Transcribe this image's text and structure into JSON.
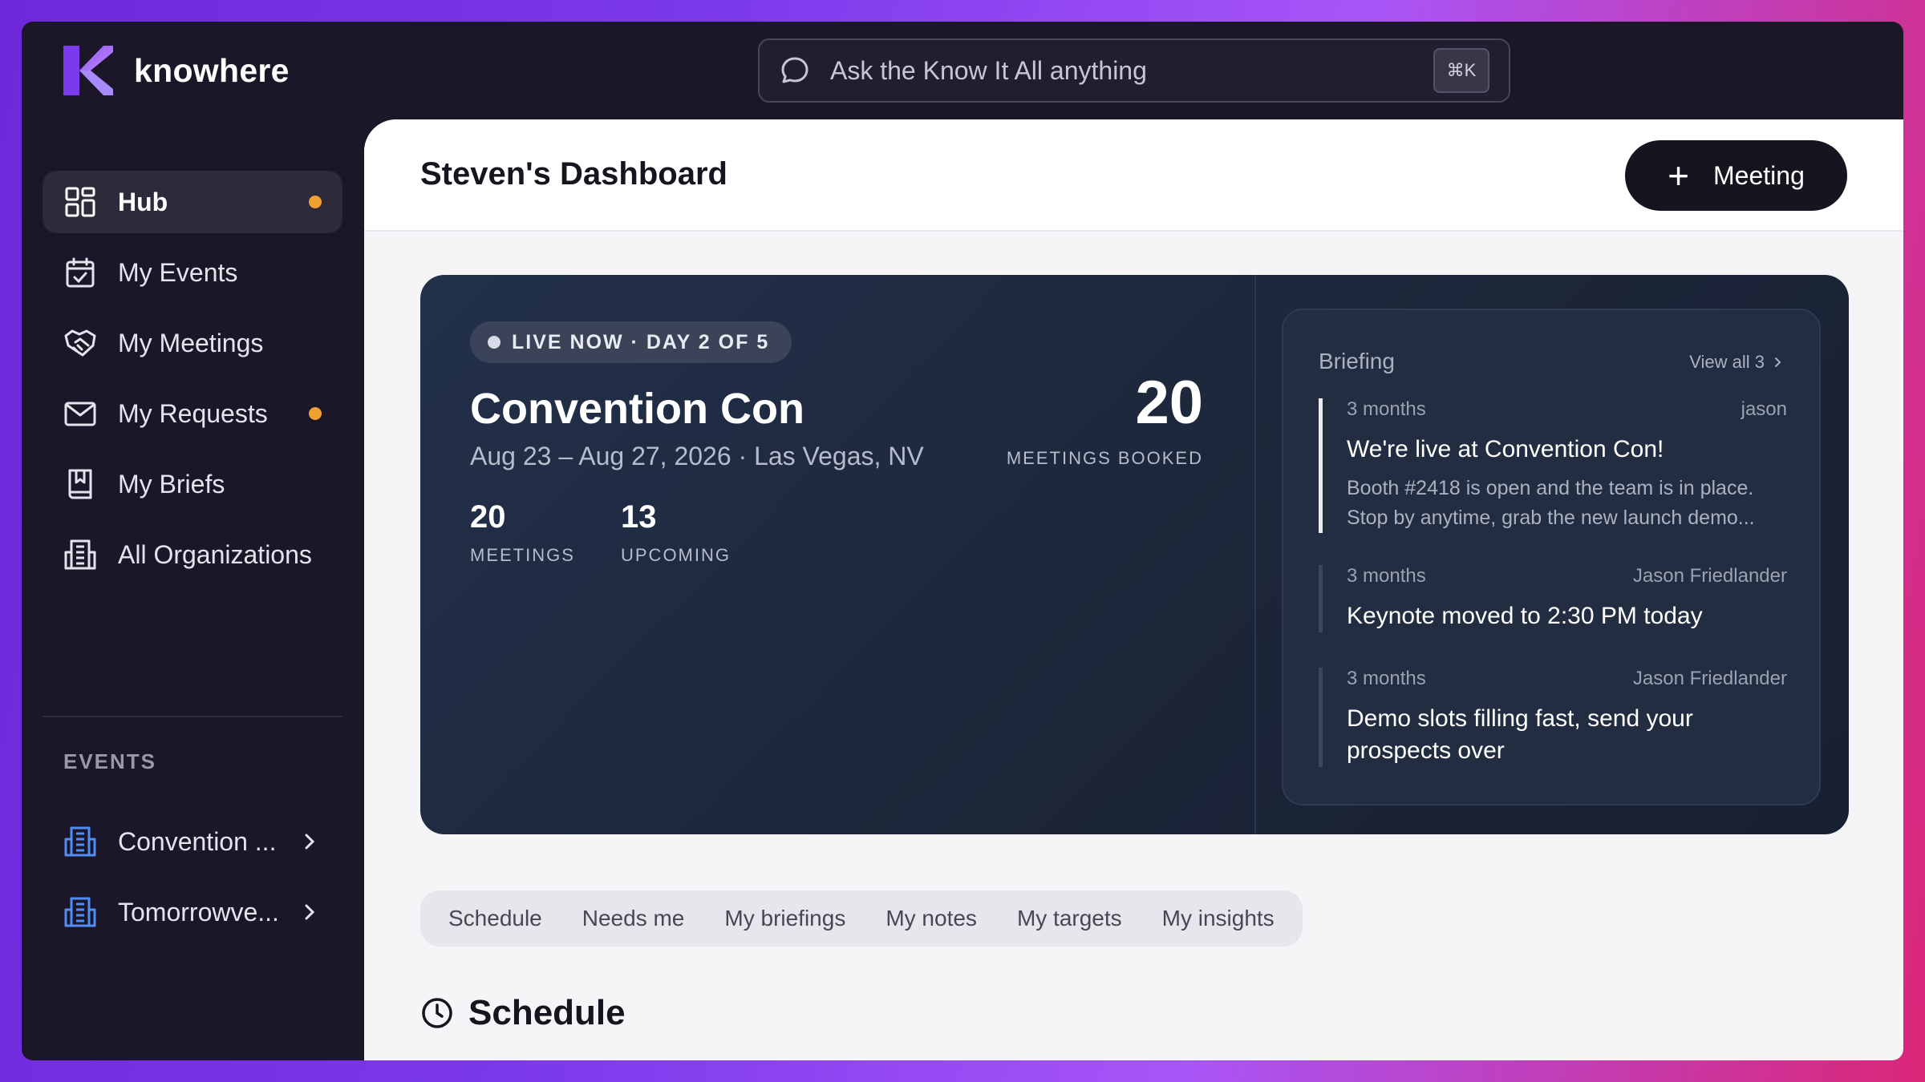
{
  "app": {
    "name": "knowhere"
  },
  "search": {
    "placeholder": "Ask the Know It All anything",
    "shortcut": "⌘K"
  },
  "sidebar": {
    "items": [
      {
        "label": "Hub",
        "icon": "grid-icon",
        "active": true,
        "badge": true
      },
      {
        "label": "My Events",
        "icon": "calendar-check-icon"
      },
      {
        "label": "My Meetings",
        "icon": "handshake-icon"
      },
      {
        "label": "My Requests",
        "icon": "mail-icon",
        "badge": true
      },
      {
        "label": "My Briefs",
        "icon": "book-icon"
      },
      {
        "label": "All Organizations",
        "icon": "building-icon"
      }
    ],
    "events_label": "EVENTS",
    "events": [
      {
        "label": "Convention ...",
        "icon": "building-icon"
      },
      {
        "label": "Tomorrowve...",
        "icon": "building-icon"
      }
    ],
    "badge_color": "#f0a030"
  },
  "header": {
    "title": "Steven's Dashboard",
    "meeting_button": "Meeting"
  },
  "hero": {
    "live_label": "LIVE NOW · DAY 2 OF 5",
    "event_name": "Convention Con",
    "event_details": "Aug 23 – Aug 27, 2026 · Las Vegas, NV",
    "stats": [
      {
        "value": "20",
        "label": "MEETINGS"
      },
      {
        "value": "13",
        "label": "UPCOMING"
      }
    ],
    "booked": {
      "value": "20",
      "label": "MEETINGS BOOKED"
    }
  },
  "briefing": {
    "title": "Briefing",
    "view_all": "View all 3",
    "items": [
      {
        "time": "3 months",
        "author": "jason",
        "headline": "We're live at Convention Con!",
        "body": "Booth #2418 is open and the team is in place. Stop by anytime, grab the new launch demo..."
      },
      {
        "time": "3 months",
        "author": "Jason Friedlander",
        "headline": "Keynote moved to 2:30 PM today",
        "body": ""
      },
      {
        "time": "3 months",
        "author": "Jason Friedlander",
        "headline": "Demo slots filling fast, send your prospects over",
        "body": ""
      }
    ]
  },
  "tabs": [
    "Schedule",
    "Needs me",
    "My briefings",
    "My notes",
    "My targets",
    "My insights"
  ],
  "schedule": {
    "title": "Schedule"
  }
}
